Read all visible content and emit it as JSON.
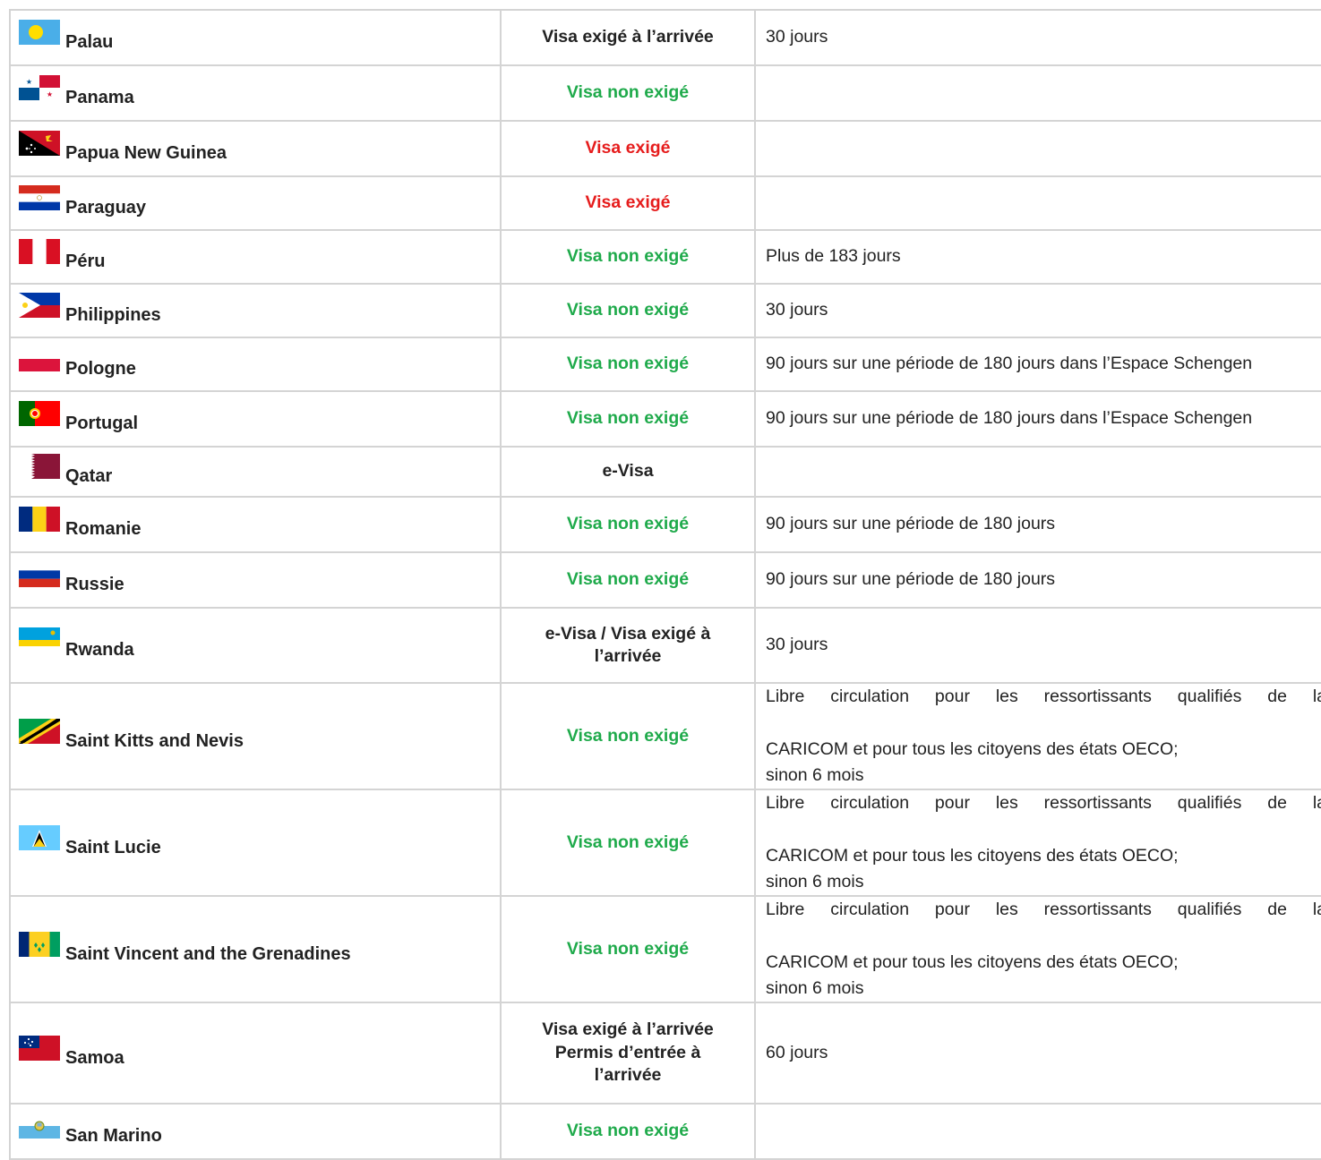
{
  "rows": [
    {
      "country": "Palau",
      "flag": "palau-flag",
      "status": "Visa exigé à l’arrivée",
      "status_color": "black",
      "stay": "30 jours",
      "height": 62
    },
    {
      "country": "Panama",
      "flag": "panama-flag",
      "status": "Visa non exigé",
      "status_color": "green",
      "stay": "",
      "height": 62
    },
    {
      "country": "Papua New Guinea",
      "flag": "papua-new-guinea-flag",
      "status": "Visa exigé",
      "status_color": "red",
      "stay": "",
      "height": 62
    },
    {
      "country": "Paraguay",
      "flag": "paraguay-flag",
      "status": "Visa exigé",
      "status_color": "red",
      "stay": "",
      "height": 60
    },
    {
      "country": "Péru",
      "flag": "peru-flag",
      "status": "Visa non exigé",
      "status_color": "green",
      "stay": "Plus de 183 jours",
      "height": 60
    },
    {
      "country": "Philippines",
      "flag": "philippines-flag",
      "status": "Visa non exigé",
      "status_color": "green",
      "stay": "30 jours",
      "height": 60
    },
    {
      "country": "Pologne",
      "flag": "poland-flag",
      "status": "Visa non exigé",
      "status_color": "green",
      "stay": "90 jours sur une période de 180 jours dans l’Espace Schengen",
      "height": 60
    },
    {
      "country": "Portugal",
      "flag": "portugal-flag",
      "status": "Visa non exigé",
      "status_color": "green",
      "stay": "90 jours sur une période de 180 jours dans l’Espace Schengen",
      "height": 62
    },
    {
      "country": "Qatar",
      "flag": "qatar-flag",
      "status": "e-Visa",
      "status_color": "black",
      "stay": "",
      "height": 56
    },
    {
      "country": "Romanie",
      "flag": "romania-flag",
      "status": "Visa non exigé",
      "status_color": "green",
      "stay": "90 jours sur une période de 180 jours",
      "height": 62
    },
    {
      "country": "Russie",
      "flag": "russia-flag",
      "status": "Visa non exigé",
      "status_color": "green",
      "stay": "90 jours sur une période de 180 jours",
      "height": 62
    },
    {
      "country": "Rwanda",
      "flag": "rwanda-flag",
      "status": "e-Visa / Visa exigé à l’arrivée",
      "status_color": "black",
      "stay": "30 jours",
      "height": 84
    },
    {
      "country": "Saint Kitts and Nevis",
      "flag": "saint-kitts-and-nevis-flag",
      "status": "Visa non exigé",
      "status_color": "green",
      "stay_long": true,
      "stay_lines": [
        "Libre circulation pour les ressortissants qualifiés de la",
        "CARICOM et pour tous les citoyens des états OECO;",
        "sinon 6 mois"
      ],
      "height": 114
    },
    {
      "country": "Saint Lucie",
      "flag": "saint-lucia-flag",
      "status": "Visa non exigé",
      "status_color": "green",
      "stay_long": true,
      "stay_lines": [
        "Libre circulation pour les ressortissants qualifiés de la",
        "CARICOM et pour tous les citoyens des états OECO;",
        "sinon 6 mois"
      ],
      "height": 114
    },
    {
      "country": "Saint Vincent and the Grenadines",
      "flag": "saint-vincent-flag",
      "status": "Visa non exigé",
      "status_color": "green",
      "stay_long": true,
      "stay_lines": [
        "Libre circulation pour les ressortissants qualifiés de la",
        "CARICOM et pour tous les citoyens des états OECO;",
        "sinon 6 mois"
      ],
      "height": 114
    },
    {
      "country": "Samoa",
      "flag": "samoa-flag",
      "status": "Visa exigé à l’arrivée\nPermis d’entrée à l’arrivée",
      "status_color": "black",
      "stay": "60 jours",
      "height": 113
    },
    {
      "country": "San Marino",
      "flag": "san-marino-flag",
      "status": "Visa non exigé",
      "status_color": "green",
      "stay": "",
      "height": 62
    }
  ]
}
